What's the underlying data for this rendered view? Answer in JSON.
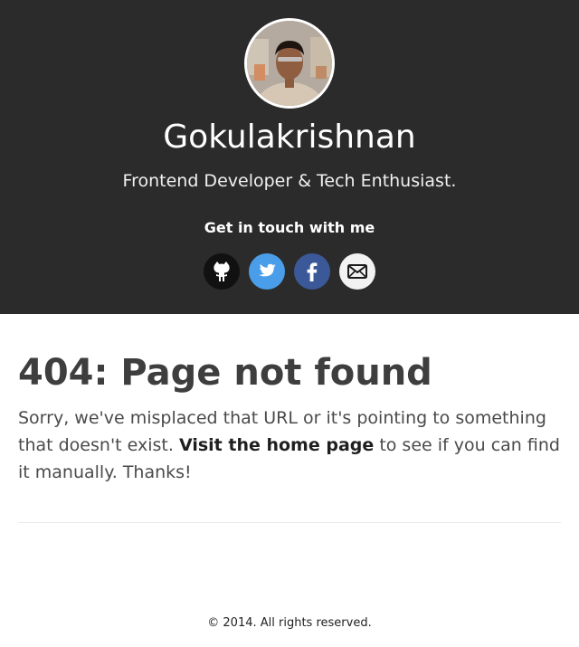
{
  "header": {
    "name": "Gokulakrishnan",
    "tagline": "Frontend Developer & Tech Enthusiast.",
    "contact_heading": "Get in touch with me",
    "socials": [
      {
        "icon": "github-icon",
        "color": "#111111"
      },
      {
        "icon": "twitter-icon",
        "color": "#4a9de8"
      },
      {
        "icon": "facebook-icon",
        "color": "#3b5998"
      },
      {
        "icon": "email-icon",
        "color": "#f2f2f2"
      }
    ],
    "background_color": "#2b2b2b"
  },
  "main": {
    "title": "404: Page not found",
    "message_before": "Sorry, we've misplaced that URL or it's pointing to something that doesn't exist. ",
    "home_link_label": "Visit the home page",
    "message_after": " to see if you can find it manually. Thanks!"
  },
  "footer": {
    "copyright": "© 2014. All rights reserved."
  }
}
